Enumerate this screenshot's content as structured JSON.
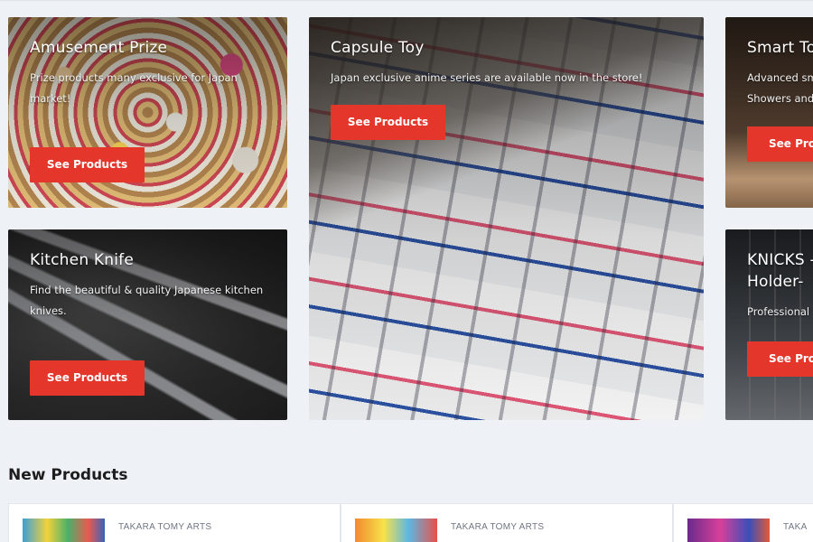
{
  "cards": [
    {
      "id": "amusement",
      "title": "Amusement Prize",
      "description": "Prize products many exclusive for Japan market!",
      "button_label": "See Products"
    },
    {
      "id": "capsule",
      "title": "Capsule Toy",
      "description": "Japan exclusive anime series are available now in the store!",
      "button_label": "See Products"
    },
    {
      "id": "toilet",
      "title": "Smart Toi",
      "description": "Advanced sm Showers and",
      "button_label": "See Pro"
    },
    {
      "id": "knife",
      "title": "Kitchen Knife",
      "description": "Find the beautiful & quality Japanese kitchen knives.",
      "button_label": "See Products"
    },
    {
      "id": "knicks",
      "title": "KNICKS - Holder-",
      "description": "Professional",
      "button_label": "See Pro"
    }
  ],
  "new_products": {
    "title": "New Products",
    "items": [
      {
        "brand": "TAKARA TOMY ARTS"
      },
      {
        "brand": "TAKARA TOMY ARTS"
      },
      {
        "brand": "TAKA"
      }
    ]
  },
  "colors": {
    "accent": "#e5362c",
    "background": "#eef2f6"
  }
}
